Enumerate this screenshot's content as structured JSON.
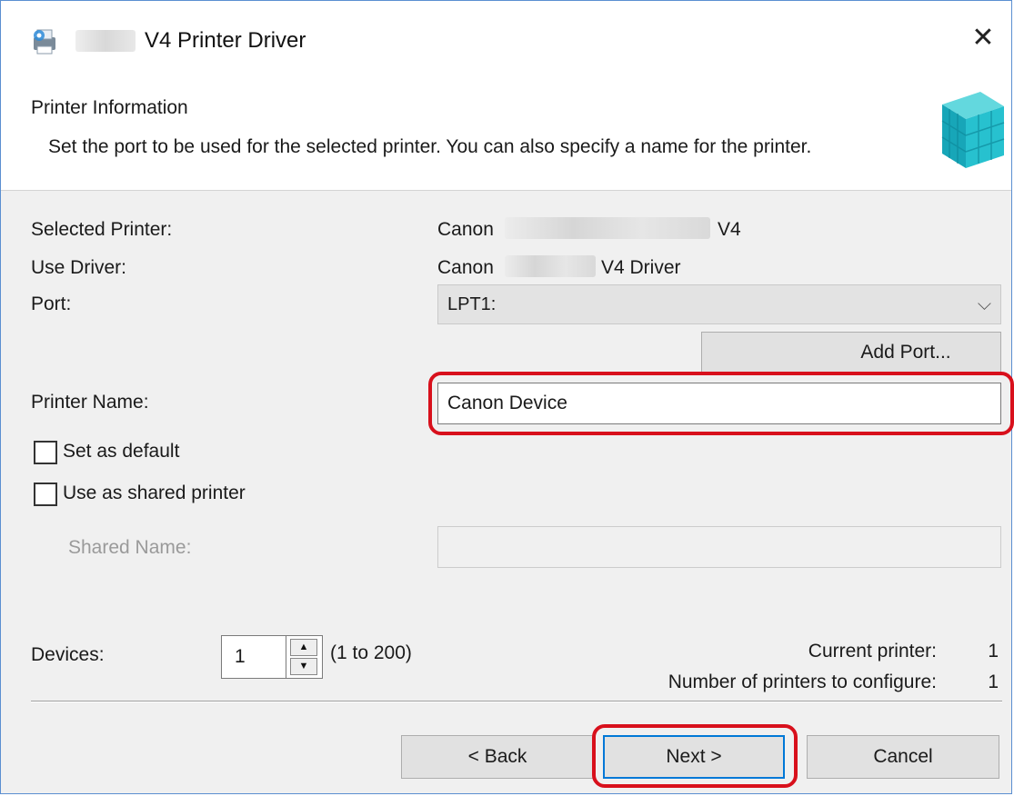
{
  "window": {
    "title": "V4 Printer Driver",
    "close_symbol": "✕"
  },
  "header": {
    "title": "Printer Information",
    "description": "Set the port to be used for the selected printer. You can also specify a name for the printer."
  },
  "fields": {
    "selected_printer_label": "Selected Printer:",
    "selected_printer_prefix": "Canon",
    "selected_printer_suffix": "V4",
    "use_driver_label": "Use Driver:",
    "use_driver_prefix": "Canon",
    "use_driver_suffix": "V4 Driver",
    "port_label": "Port:",
    "port_value": "LPT1:",
    "add_port_label": "Add Port...",
    "printer_name_label": "Printer Name:",
    "printer_name_value": "Canon Device",
    "set_default_label": "Set as default",
    "set_default_checked": false,
    "shared_printer_label": "Use as shared printer",
    "shared_printer_checked": false,
    "shared_name_label": "Shared Name:",
    "shared_name_value": ""
  },
  "devices": {
    "label": "Devices:",
    "value": "1",
    "range": "(1 to 200)",
    "current_printer_label": "Current printer:",
    "current_printer_value": "1",
    "configure_label": "Number of printers to configure:",
    "configure_value": "1"
  },
  "footer": {
    "back_label": "< Back",
    "next_label": "Next >",
    "cancel_label": "Cancel"
  },
  "colors": {
    "highlight": "#d8101c",
    "accent": "#0078d7"
  }
}
